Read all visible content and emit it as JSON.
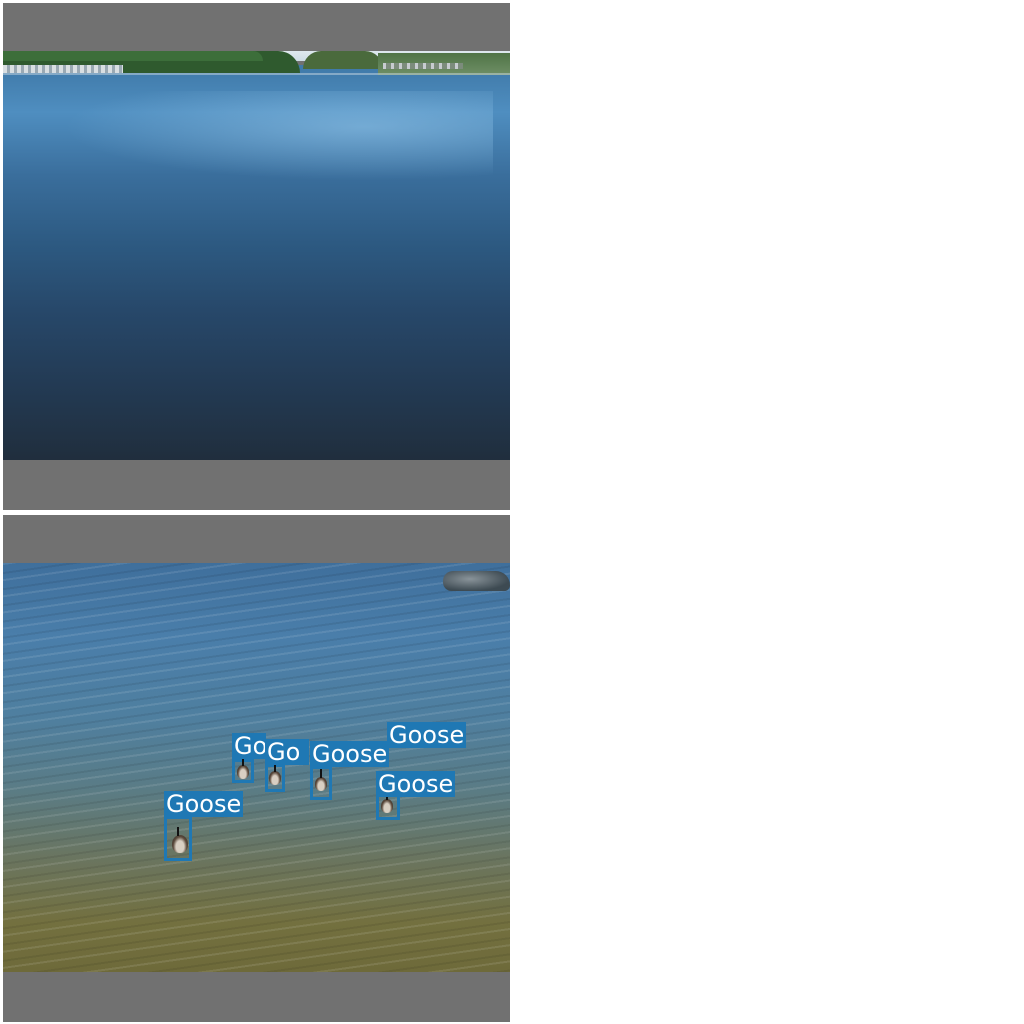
{
  "panels": [
    {
      "id": "panel-1",
      "scene": "lake-shoreline",
      "detections": []
    },
    {
      "id": "panel-2",
      "scene": "geese-on-water",
      "detections": [
        {
          "label": "Goose",
          "visible_text": "Go"
        },
        {
          "label": "Goose",
          "visible_text": "Go"
        },
        {
          "label": "Goose",
          "visible_text": "Goose"
        },
        {
          "label": "Goose",
          "visible_text": "Goose"
        },
        {
          "label": "Goose",
          "visible_text": "Goose"
        },
        {
          "label": "Goose",
          "visible_text": "Goose"
        }
      ]
    }
  ],
  "colors": {
    "background": "#ffffff",
    "letterbox": "#717171",
    "detection_box": "#1f78b4",
    "label_text": "#ffffff"
  }
}
